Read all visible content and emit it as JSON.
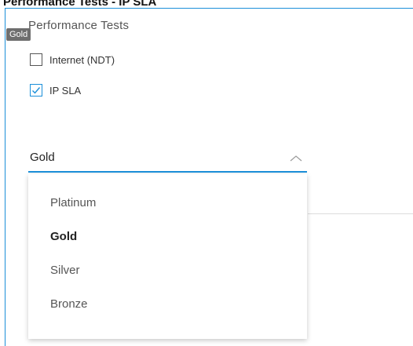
{
  "page": {
    "heading": "Performance Tests - IP SLA"
  },
  "section": {
    "title": "Performance Tests"
  },
  "tooltip": {
    "text": "Gold"
  },
  "tests": [
    {
      "label": "Internet (NDT)",
      "checked": false
    },
    {
      "label": "IP SLA",
      "checked": true
    }
  ],
  "select": {
    "value": "Gold",
    "options": [
      {
        "label": "Platinum",
        "selected": false
      },
      {
        "label": "Gold",
        "selected": true
      },
      {
        "label": "Silver",
        "selected": false
      },
      {
        "label": "Bronze",
        "selected": false
      }
    ]
  },
  "colors": {
    "accent": "#1b8fd9"
  }
}
